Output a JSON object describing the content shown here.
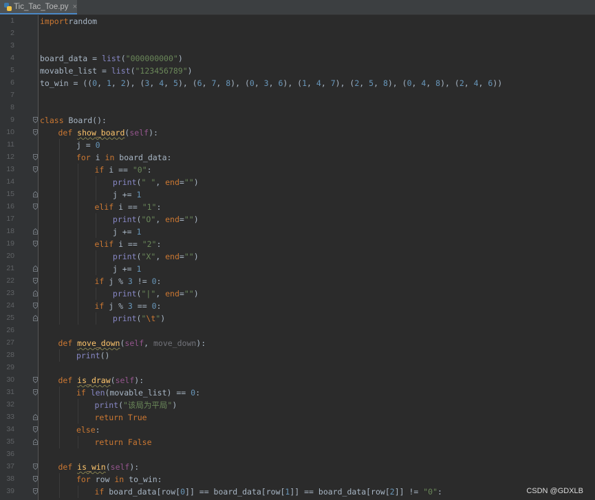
{
  "tab": {
    "file_name": "Tic_Tac_Toe.py",
    "close_glyph": "×"
  },
  "watermark": "CSDN @GDXLB",
  "lines": [
    {
      "n": "1",
      "indent": 0,
      "fold": "",
      "tokens": [
        [
          "kw",
          "import"
        ],
        [
          "",
          "random"
        ]
      ]
    },
    {
      "n": "2",
      "indent": 0,
      "fold": "",
      "tokens": []
    },
    {
      "n": "3",
      "indent": 0,
      "fold": "",
      "tokens": []
    },
    {
      "n": "4",
      "indent": 0,
      "fold": "",
      "tokens": [
        [
          "",
          "board_data = "
        ],
        [
          "bi",
          "list"
        ],
        [
          "",
          "("
        ],
        [
          "str",
          "\"000000000\""
        ],
        [
          "",
          ")"
        ]
      ]
    },
    {
      "n": "5",
      "indent": 0,
      "fold": "",
      "tokens": [
        [
          "",
          "movable_list = "
        ],
        [
          "bi",
          "list"
        ],
        [
          "",
          "("
        ],
        [
          "str",
          "\"123456789\""
        ],
        [
          "",
          ")"
        ]
      ]
    },
    {
      "n": "6",
      "indent": 0,
      "fold": "",
      "tokens": [
        [
          "",
          "to_win = (("
        ],
        [
          "num",
          "0"
        ],
        [
          "",
          ", "
        ],
        [
          "num",
          "1"
        ],
        [
          "",
          ", "
        ],
        [
          "num",
          "2"
        ],
        [
          "",
          "), ("
        ],
        [
          "num",
          "3"
        ],
        [
          "",
          ", "
        ],
        [
          "num",
          "4"
        ],
        [
          "",
          ", "
        ],
        [
          "num",
          "5"
        ],
        [
          "",
          "), ("
        ],
        [
          "num",
          "6"
        ],
        [
          "",
          ", "
        ],
        [
          "num",
          "7"
        ],
        [
          "",
          ", "
        ],
        [
          "num",
          "8"
        ],
        [
          "",
          "), ("
        ],
        [
          "num",
          "0"
        ],
        [
          "",
          ", "
        ],
        [
          "num",
          "3"
        ],
        [
          "",
          ", "
        ],
        [
          "num",
          "6"
        ],
        [
          "",
          "), ("
        ],
        [
          "num",
          "1"
        ],
        [
          "",
          ", "
        ],
        [
          "num",
          "4"
        ],
        [
          "",
          ", "
        ],
        [
          "num",
          "7"
        ],
        [
          "",
          "), ("
        ],
        [
          "num",
          "2"
        ],
        [
          "",
          ", "
        ],
        [
          "num",
          "5"
        ],
        [
          "",
          ", "
        ],
        [
          "num",
          "8"
        ],
        [
          "",
          "), ("
        ],
        [
          "num",
          "0"
        ],
        [
          "",
          ", "
        ],
        [
          "num",
          "4"
        ],
        [
          "",
          ", "
        ],
        [
          "num",
          "8"
        ],
        [
          "",
          "), ("
        ],
        [
          "num",
          "2"
        ],
        [
          "",
          ", "
        ],
        [
          "num",
          "4"
        ],
        [
          "",
          ", "
        ],
        [
          "num",
          "6"
        ],
        [
          "",
          "))"
        ]
      ]
    },
    {
      "n": "7",
      "indent": 0,
      "fold": "",
      "tokens": []
    },
    {
      "n": "8",
      "indent": 0,
      "fold": "",
      "tokens": []
    },
    {
      "n": "9",
      "indent": 0,
      "fold": "open",
      "tokens": [
        [
          "kw",
          "class "
        ],
        [
          "",
          "Board"
        ],
        [
          "",
          "():"
        ]
      ]
    },
    {
      "n": "10",
      "indent": 1,
      "fold": "open",
      "tokens": [
        [
          "kw",
          "def "
        ],
        [
          "fn",
          "show_board"
        ],
        [
          "",
          "("
        ],
        [
          "self",
          "self"
        ],
        [
          "",
          "):"
        ]
      ]
    },
    {
      "n": "11",
      "indent": 2,
      "fold": "",
      "tokens": [
        [
          "",
          "j = "
        ],
        [
          "num",
          "0"
        ]
      ]
    },
    {
      "n": "12",
      "indent": 2,
      "fold": "open",
      "tokens": [
        [
          "kw",
          "for "
        ],
        [
          "",
          "i "
        ],
        [
          "kw",
          "in "
        ],
        [
          "",
          "board_data:"
        ]
      ]
    },
    {
      "n": "13",
      "indent": 3,
      "fold": "open",
      "tokens": [
        [
          "kw",
          "if "
        ],
        [
          "",
          "i == "
        ],
        [
          "str",
          "\"0\""
        ],
        [
          "",
          ":"
        ]
      ]
    },
    {
      "n": "14",
      "indent": 4,
      "fold": "",
      "tokens": [
        [
          "bi",
          "print"
        ],
        [
          "",
          "("
        ],
        [
          "str",
          "\" \""
        ],
        [
          "",
          ", "
        ],
        [
          "kw",
          "end"
        ],
        [
          "",
          "="
        ],
        [
          "str",
          "\"\""
        ],
        [
          "",
          ")"
        ]
      ]
    },
    {
      "n": "15",
      "indent": 4,
      "fold": "close",
      "tokens": [
        [
          "",
          "j += "
        ],
        [
          "num",
          "1"
        ]
      ]
    },
    {
      "n": "16",
      "indent": 3,
      "fold": "open",
      "tokens": [
        [
          "kw",
          "elif "
        ],
        [
          "",
          "i == "
        ],
        [
          "str",
          "\"1\""
        ],
        [
          "",
          ":"
        ]
      ]
    },
    {
      "n": "17",
      "indent": 4,
      "fold": "",
      "tokens": [
        [
          "bi",
          "print"
        ],
        [
          "",
          "("
        ],
        [
          "str",
          "\"O\""
        ],
        [
          "",
          ", "
        ],
        [
          "kw",
          "end"
        ],
        [
          "",
          "="
        ],
        [
          "str",
          "\"\""
        ],
        [
          "",
          ")"
        ]
      ]
    },
    {
      "n": "18",
      "indent": 4,
      "fold": "close",
      "tokens": [
        [
          "",
          "j += "
        ],
        [
          "num",
          "1"
        ]
      ]
    },
    {
      "n": "19",
      "indent": 3,
      "fold": "open",
      "tokens": [
        [
          "kw",
          "elif "
        ],
        [
          "",
          "i == "
        ],
        [
          "str",
          "\"2\""
        ],
        [
          "",
          ":"
        ]
      ]
    },
    {
      "n": "20",
      "indent": 4,
      "fold": "",
      "tokens": [
        [
          "bi",
          "print"
        ],
        [
          "",
          "("
        ],
        [
          "str",
          "\"X\""
        ],
        [
          "",
          ", "
        ],
        [
          "kw",
          "end"
        ],
        [
          "",
          "="
        ],
        [
          "str",
          "\"\""
        ],
        [
          "",
          ")"
        ]
      ]
    },
    {
      "n": "21",
      "indent": 4,
      "fold": "close",
      "tokens": [
        [
          "",
          "j += "
        ],
        [
          "num",
          "1"
        ]
      ]
    },
    {
      "n": "22",
      "indent": 3,
      "fold": "open",
      "tokens": [
        [
          "kw",
          "if "
        ],
        [
          "",
          "j % "
        ],
        [
          "num",
          "3"
        ],
        [
          "",
          " != "
        ],
        [
          "num",
          "0"
        ],
        [
          "",
          ":"
        ]
      ]
    },
    {
      "n": "23",
      "indent": 4,
      "fold": "close",
      "tokens": [
        [
          "bi",
          "print"
        ],
        [
          "",
          "("
        ],
        [
          "str",
          "\"|\""
        ],
        [
          "",
          ", "
        ],
        [
          "kw",
          "end"
        ],
        [
          "",
          "="
        ],
        [
          "str",
          "\"\""
        ],
        [
          "",
          ")"
        ]
      ]
    },
    {
      "n": "24",
      "indent": 3,
      "fold": "open",
      "tokens": [
        [
          "kw",
          "if "
        ],
        [
          "",
          "j % "
        ],
        [
          "num",
          "3"
        ],
        [
          "",
          " == "
        ],
        [
          "num",
          "0"
        ],
        [
          "",
          ":"
        ]
      ]
    },
    {
      "n": "25",
      "indent": 4,
      "fold": "close",
      "tokens": [
        [
          "bi",
          "print"
        ],
        [
          "",
          "("
        ],
        [
          "str",
          "\""
        ],
        [
          "esc",
          "\\t"
        ],
        [
          "str",
          "\""
        ],
        [
          "",
          ")"
        ]
      ]
    },
    {
      "n": "26",
      "indent": 0,
      "fold": "",
      "tokens": []
    },
    {
      "n": "27",
      "indent": 1,
      "fold": "",
      "tokens": [
        [
          "kw",
          "def "
        ],
        [
          "fn",
          "move_down"
        ],
        [
          "",
          "("
        ],
        [
          "self",
          "self"
        ],
        [
          "",
          ", "
        ],
        [
          "unused",
          "move_down"
        ],
        [
          "",
          "):"
        ]
      ]
    },
    {
      "n": "28",
      "indent": 2,
      "fold": "",
      "tokens": [
        [
          "bi",
          "print"
        ],
        [
          "",
          "()"
        ]
      ]
    },
    {
      "n": "29",
      "indent": 0,
      "fold": "",
      "tokens": []
    },
    {
      "n": "30",
      "indent": 1,
      "fold": "open",
      "tokens": [
        [
          "kw",
          "def "
        ],
        [
          "fn",
          "is_draw"
        ],
        [
          "",
          "("
        ],
        [
          "self",
          "self"
        ],
        [
          "",
          "):"
        ]
      ]
    },
    {
      "n": "31",
      "indent": 2,
      "fold": "open",
      "tokens": [
        [
          "kw",
          "if "
        ],
        [
          "bi",
          "len"
        ],
        [
          "",
          "(movable_list) == "
        ],
        [
          "num",
          "0"
        ],
        [
          "",
          ":"
        ]
      ]
    },
    {
      "n": "32",
      "indent": 3,
      "fold": "",
      "tokens": [
        [
          "bi",
          "print"
        ],
        [
          "",
          "("
        ],
        [
          "str",
          "\"该局为平局\""
        ],
        [
          "",
          ")"
        ]
      ]
    },
    {
      "n": "33",
      "indent": 3,
      "fold": "close",
      "tokens": [
        [
          "kw",
          "return True"
        ]
      ]
    },
    {
      "n": "34",
      "indent": 2,
      "fold": "open",
      "tokens": [
        [
          "kw",
          "else"
        ],
        [
          "",
          ":"
        ]
      ]
    },
    {
      "n": "35",
      "indent": 3,
      "fold": "close",
      "tokens": [
        [
          "kw",
          "return False"
        ]
      ]
    },
    {
      "n": "36",
      "indent": 0,
      "fold": "",
      "tokens": []
    },
    {
      "n": "37",
      "indent": 1,
      "fold": "open",
      "tokens": [
        [
          "kw",
          "def "
        ],
        [
          "fn",
          "is_win"
        ],
        [
          "",
          "("
        ],
        [
          "self",
          "self"
        ],
        [
          "",
          "):"
        ]
      ]
    },
    {
      "n": "38",
      "indent": 2,
      "fold": "open",
      "tokens": [
        [
          "kw",
          "for "
        ],
        [
          "",
          "row "
        ],
        [
          "kw",
          "in "
        ],
        [
          "",
          "to_win:"
        ]
      ]
    },
    {
      "n": "39",
      "indent": 3,
      "fold": "open",
      "tokens": [
        [
          "kw",
          "if "
        ],
        [
          "",
          "board_data[row["
        ],
        [
          "num",
          "0"
        ],
        [
          "",
          "]] == board_data[row["
        ],
        [
          "num",
          "1"
        ],
        [
          "",
          "]] == board_data[row["
        ],
        [
          "num",
          "2"
        ],
        [
          "",
          "]] != "
        ],
        [
          "str",
          "\"0\""
        ],
        [
          "",
          ":"
        ]
      ]
    }
  ]
}
